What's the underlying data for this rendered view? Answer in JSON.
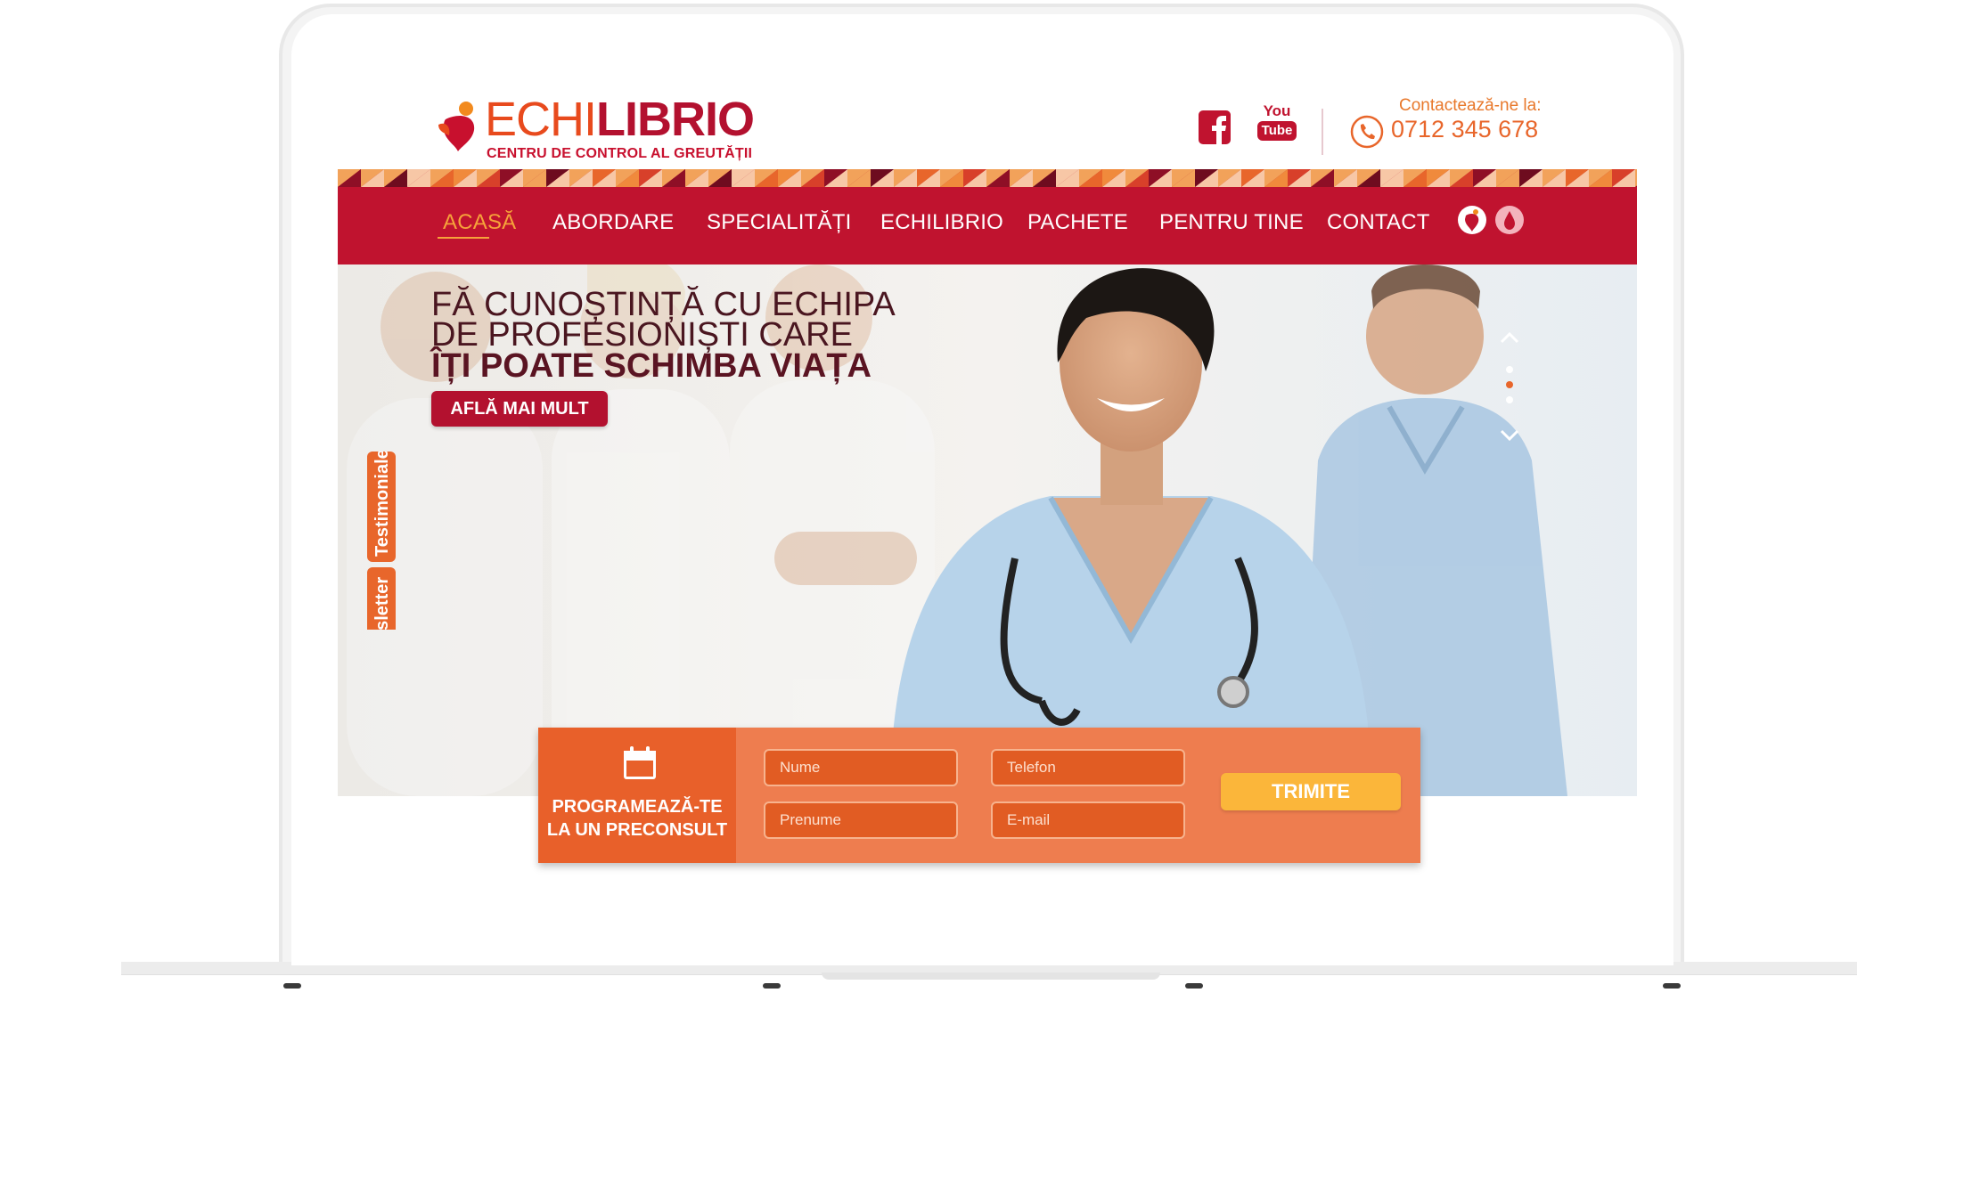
{
  "header": {
    "logo_light": "ECHI",
    "logo_bold": "LIBRIO",
    "logo_tagline": "CENTRU DE CONTROL AL GREUTĂȚII",
    "contact_label": "Contactează-ne la:",
    "contact_phone": "0712 345 678",
    "youtube_text_top": "You",
    "youtube_text_bottom": "Tube"
  },
  "nav": {
    "items": [
      "ACASĂ",
      "ABORDARE",
      "SPECIALITĂȚI",
      "ECHILIBRIO",
      "PACHETE",
      "PENTRU TINE",
      "CONTACT"
    ],
    "active": "ACASĂ"
  },
  "hero": {
    "line1": "FĂ CUNOȘTINȚĂ CU ECHIPA",
    "line2": "DE PROFESIONIȘTI CARE",
    "line3": "ÎȚI POATE SCHIMBA VIAȚA",
    "cta": "AFLĂ MAI MULT",
    "slides_total": 3,
    "slide_active": 2
  },
  "side_tabs": {
    "testimonials": "Testimoniale",
    "newsletter": "Newsletter"
  },
  "form": {
    "title_line1": "PROGRAMEAZĂ-TE",
    "title_line2": "LA UN PRECONSULT",
    "nume_placeholder": "Nume",
    "prenume_placeholder": "Prenume",
    "telefon_placeholder": "Telefon",
    "email_placeholder": "E-mail",
    "submit": "TRIMITE"
  },
  "colors": {
    "brand_red": "#c0132f",
    "accent_orange": "#e8662b",
    "active_nav": "#f6a23a",
    "button_yellow": "#fbb63a"
  }
}
